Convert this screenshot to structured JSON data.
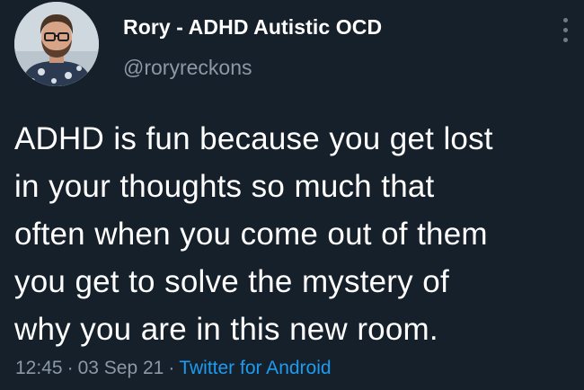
{
  "author": {
    "display_name": "Rory - ADHD Autistic OCD",
    "handle": "@roryreckons"
  },
  "tweet": {
    "lines": [
      "ADHD is fun because you get lost",
      "in your thoughts so much that",
      "often when you come out of them",
      "you get to solve the mystery of",
      "why you are in this new room."
    ],
    "time": "12:45",
    "separator": "·",
    "date": "03 Sep 21",
    "source": "Twitter for Android"
  },
  "icons": {
    "more": "more-vertical-icon",
    "avatar": "profile-photo"
  },
  "colors": {
    "background": "#15202b",
    "primary_text": "#ffffff",
    "secondary_text": "#8b98a5",
    "link": "#1d9bf0"
  }
}
